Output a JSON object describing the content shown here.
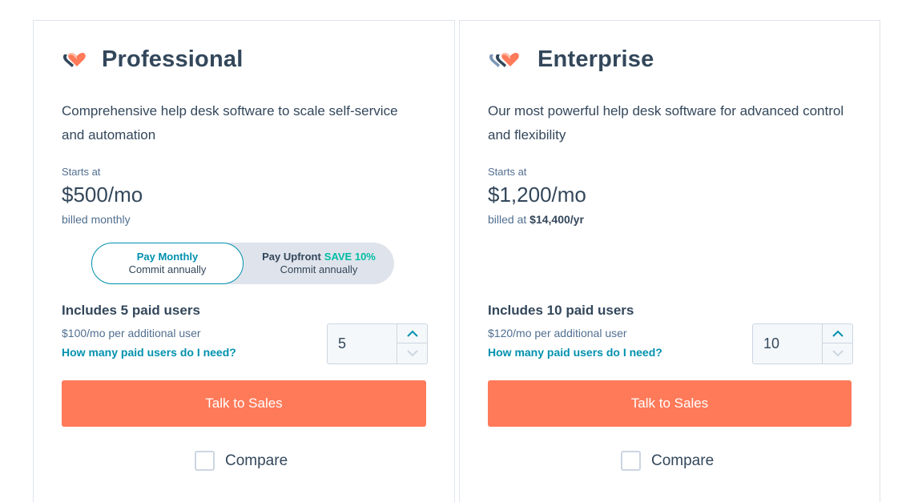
{
  "plans": [
    {
      "name": "Professional",
      "description": "Comprehensive help desk software to scale self-service and automation",
      "starts_label": "Starts at",
      "price": "$500/mo",
      "billed_prefix": "billed monthly",
      "billed_amount": "",
      "toggle": {
        "monthly_title": "Pay Monthly",
        "monthly_sub": "Commit annually",
        "upfront_title": "Pay Upfront",
        "upfront_save": "SAVE 10%",
        "upfront_sub": "Commit annually",
        "selected": "monthly"
      },
      "includes": "Includes 5 paid users",
      "additional": "$100/mo per additional user",
      "help_link": "How many paid users do I need?",
      "users_value": "5",
      "cta": "Talk to Sales",
      "compare": "Compare",
      "compare_checked": false,
      "logo_icon": "hearts-logo-icon"
    },
    {
      "name": "Enterprise",
      "description": "Our most powerful help desk software for advanced control and flexibility",
      "starts_label": "Starts at",
      "price": "$1,200/mo",
      "billed_prefix": "billed at",
      "billed_amount": "$14,400/yr",
      "includes": "Includes 10 paid users",
      "additional": "$120/mo per additional user",
      "help_link": "How many paid users do I need?",
      "users_value": "10",
      "cta": "Talk to Sales",
      "compare": "Compare",
      "compare_checked": false,
      "logo_icon": "hearts-logo-icon"
    }
  ],
  "colors": {
    "accent": "#ff7a59",
    "link": "#0091ae",
    "save": "#00bda5",
    "text": "#33475b",
    "muted": "#516f90",
    "border": "#dfe3eb"
  }
}
